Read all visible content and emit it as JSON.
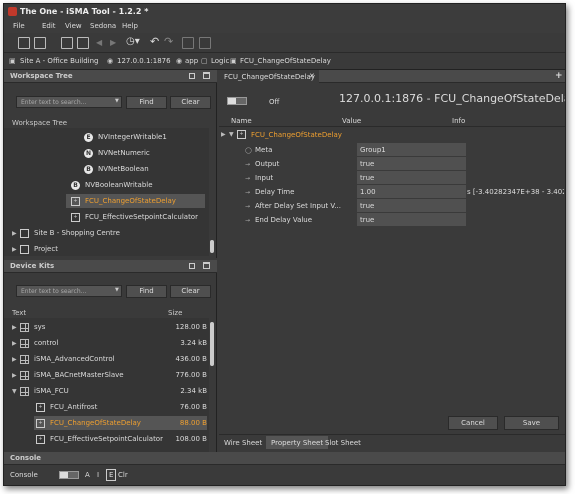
{
  "window": {
    "title": "The One - iSMA Tool - 1.2.2 *"
  },
  "menu": [
    "File",
    "Edit",
    "View",
    "Sedona",
    "Help"
  ],
  "breadcrumb": {
    "site": "Site A - Office Building",
    "ip": "127.0.0.1:1876",
    "app": "app",
    "logic": "Logic",
    "current": "FCU_ChangeOfStateDelay"
  },
  "workspace": {
    "title": "Workspace Tree",
    "placeholder": "Enter text to search...",
    "find": "Find",
    "clear": "Clear",
    "tree_label": "Workspace Tree",
    "items": [
      {
        "label": "NVIntegerWritable1",
        "icon": "E"
      },
      {
        "label": "NVNetNumeric",
        "icon": "N"
      },
      {
        "label": "NVNetBoolean",
        "icon": "B"
      },
      {
        "label": "NVBooleanWritable",
        "icon": "B"
      },
      {
        "label": "FCU_ChangeOfStateDelay"
      },
      {
        "label": "FCU_EffectiveSetpointCalculator"
      },
      {
        "label": "Site B - Shopping Centre"
      },
      {
        "label": "Project"
      }
    ]
  },
  "devicekits": {
    "title": "Device Kits",
    "placeholder": "Enter text to search...",
    "find": "Find",
    "clear": "Clear",
    "col_text": "Text",
    "col_size": "Size",
    "items": [
      {
        "label": "sys",
        "size": "128.00 B"
      },
      {
        "label": "control",
        "size": "3.24 kB"
      },
      {
        "label": "iSMA_AdvancedControl",
        "size": "436.00 B"
      },
      {
        "label": "iSMA_BACnetMasterSlave",
        "size": "776.00 B"
      },
      {
        "label": "iSMA_FCU",
        "size": "2.34 kB"
      },
      {
        "label": "FCU_Antifrost",
        "size": "76.00 B"
      },
      {
        "label": "FCU_ChangeOfStateDelay",
        "size": "88.00 B"
      },
      {
        "label": "FCU_EffectiveSetpointCalculator",
        "size": "108.00 B"
      }
    ]
  },
  "editor": {
    "tab": "FCU_ChangeOfStateDelay",
    "toggle": "Off",
    "header": "127.0.0.1:1876 - FCU_ChangeOfStateDelay [iS",
    "cols": {
      "name": "Name",
      "value": "Value",
      "info": "Info"
    },
    "root": "FCU_ChangeOfStateDelay",
    "props": [
      {
        "name": "Meta",
        "value": "Group1",
        "info": ""
      },
      {
        "name": "Output",
        "value": "true",
        "info": ""
      },
      {
        "name": "Input",
        "value": "true",
        "info": ""
      },
      {
        "name": "Delay Time",
        "value": "1.00",
        "info": "s [-3.40282347E+38 - 3.402823..."
      },
      {
        "name": "After Delay Set Input V...",
        "value": "true",
        "info": ""
      },
      {
        "name": "End Delay Value",
        "value": "true",
        "info": ""
      }
    ],
    "cancel": "Cancel",
    "save": "Save",
    "bottom_tabs": [
      "Wire Sheet",
      "Property Sheet",
      "Slot Sheet"
    ]
  },
  "console": {
    "title": "Console",
    "label": "Console",
    "a": "A",
    "i": "I",
    "e": "E",
    "clr": "Clr"
  }
}
